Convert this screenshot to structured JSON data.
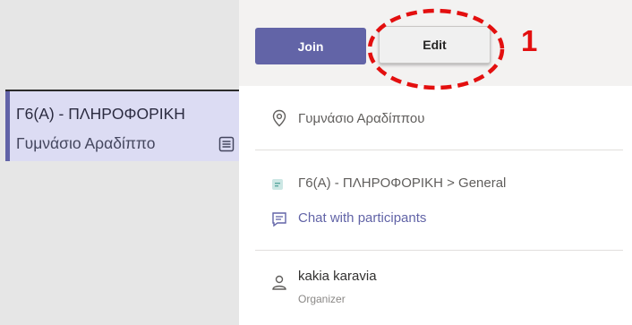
{
  "event_card": {
    "title": "Γ6(Α) - ΠΛΗΡΟΦΟΡΙΚΗ",
    "location": "Γυμνάσιο Αραδίππο"
  },
  "popup": {
    "join_label": "Join",
    "edit_label": "Edit",
    "step_number": "1",
    "location": "Γυμνάσιο Αραδίππου",
    "channel": "Γ6(Α) - ΠΛΗΡΟΦΟΡΙΚΗ > General",
    "chat_link": "Chat with participants",
    "organizer_name": "kakia karavia",
    "organizer_role": "Organizer"
  },
  "colors": {
    "accent": "#6264a7",
    "annotation": "#e30f0f"
  },
  "icons": [
    "location-pin-icon",
    "channel-icon",
    "chat-icon",
    "person-icon",
    "list-icon"
  ]
}
